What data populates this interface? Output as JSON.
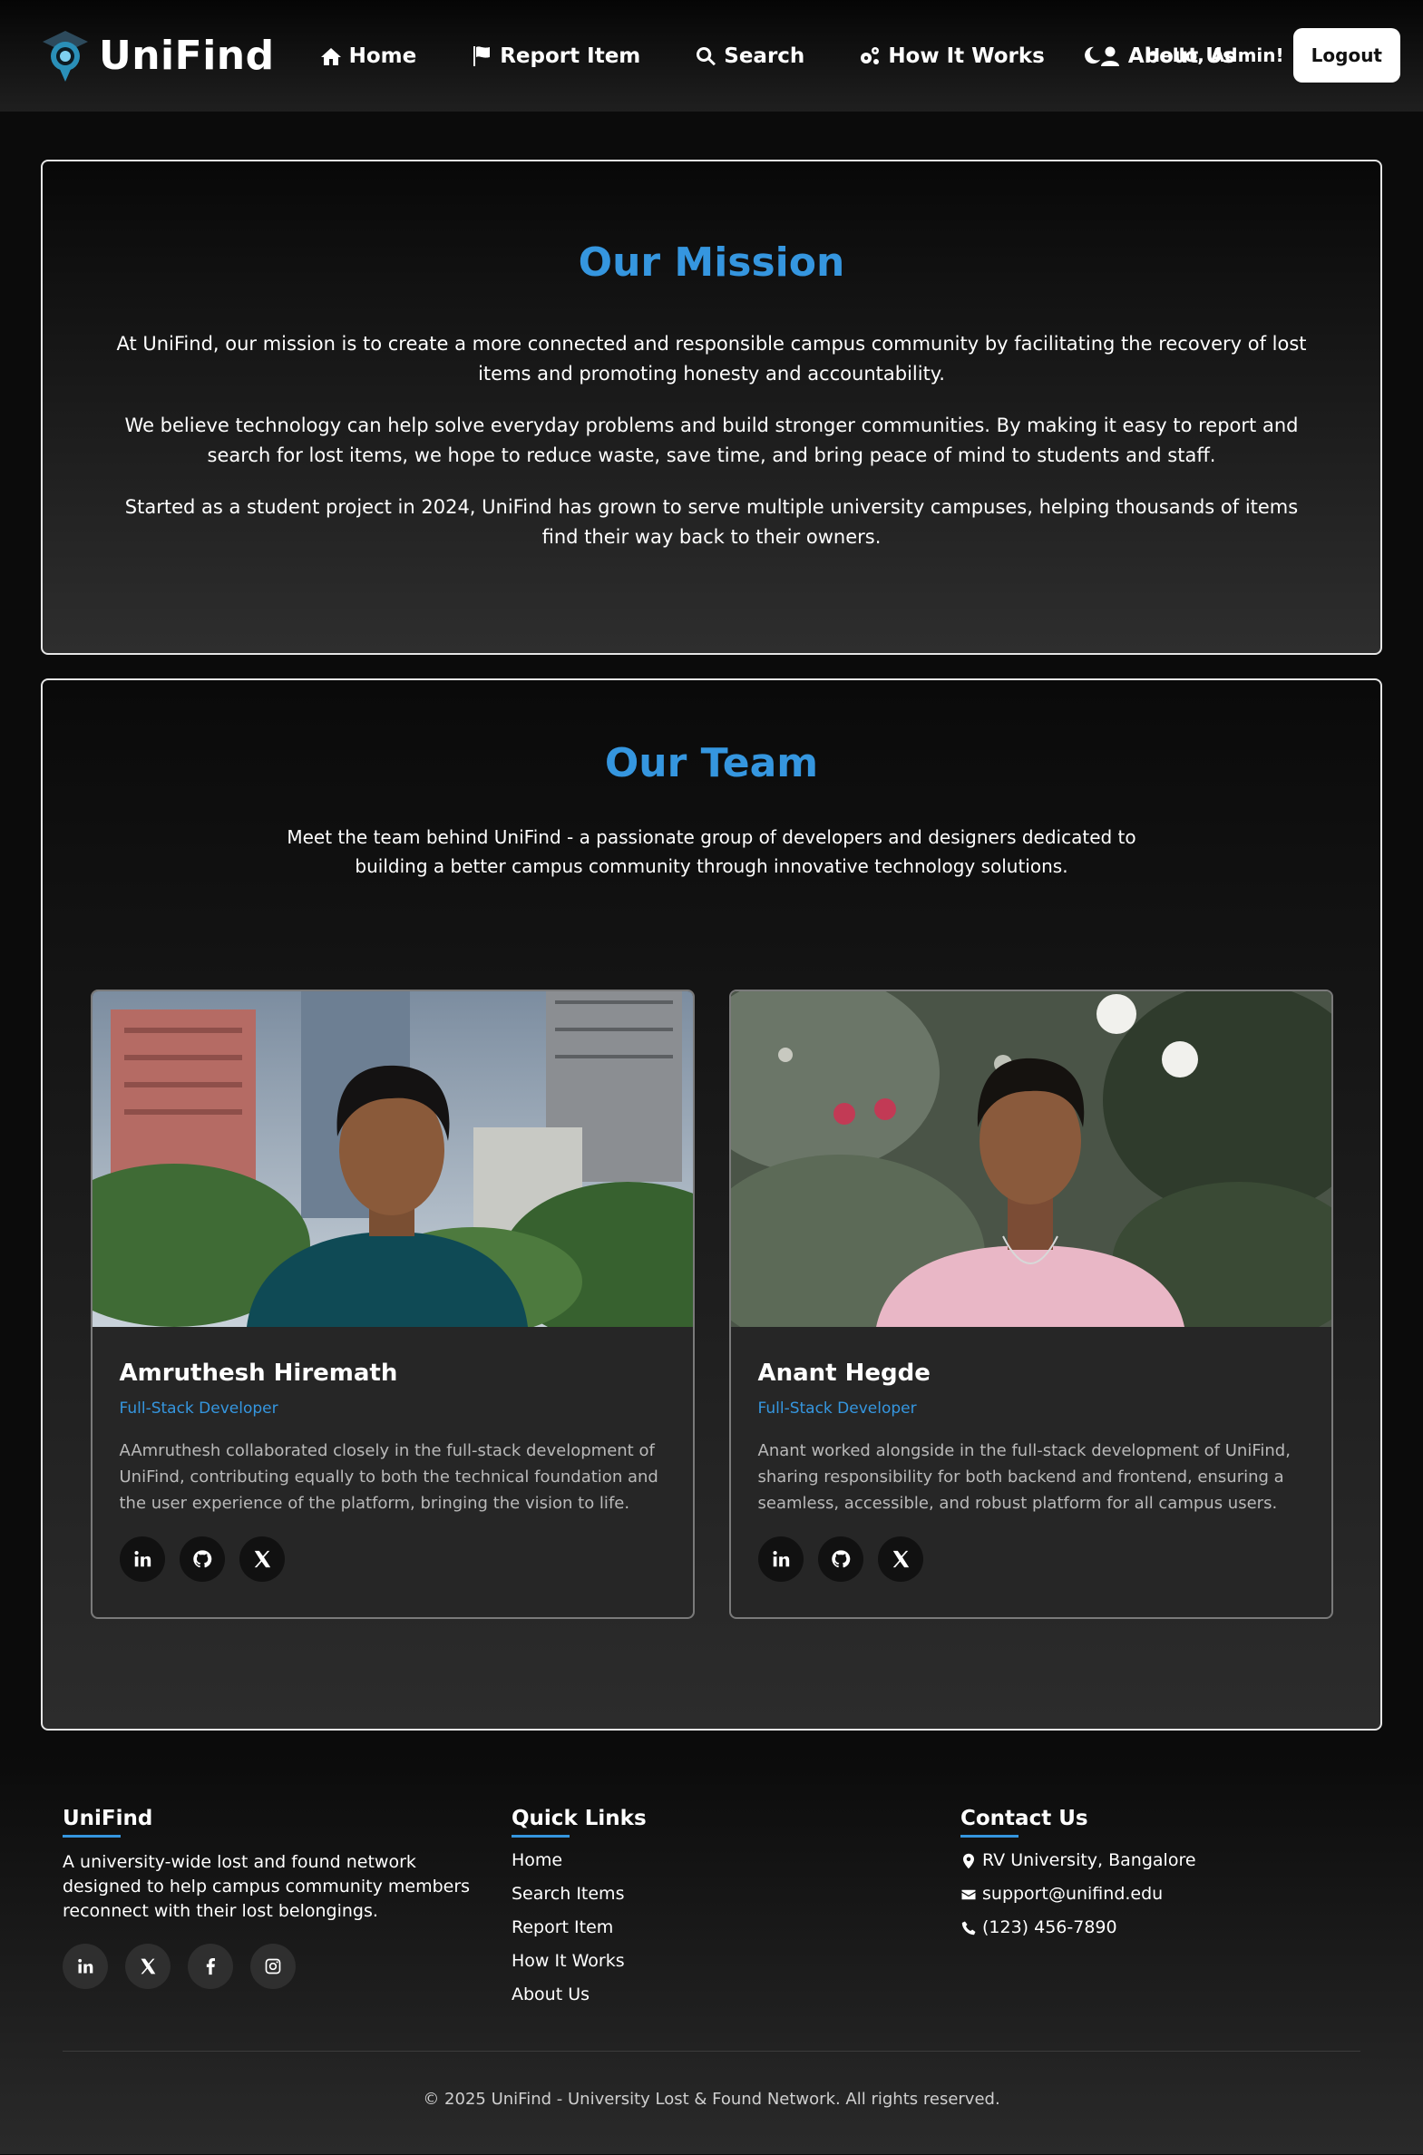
{
  "nav": {
    "brand": "UniFind",
    "links": [
      {
        "label": "Home",
        "icon": "home-icon"
      },
      {
        "label": "Report Item",
        "icon": "flag-icon"
      },
      {
        "label": "Search",
        "icon": "search-icon"
      },
      {
        "label": "How It Works",
        "icon": "gears-icon"
      },
      {
        "label": "About Us",
        "icon": "user-icon"
      }
    ],
    "theme_icon": "moon-icon",
    "greeting": "Hello, Admin!",
    "logout": "Logout"
  },
  "mission": {
    "title": "Our Mission",
    "paragraphs": [
      "At UniFind, our mission is to create a more connected and responsible campus community by facilitating the recovery of lost items and promoting honesty and accountability.",
      "We believe technology can help solve everyday problems and build stronger communities. By making it easy to report and search for lost items, we hope to reduce waste, save time, and bring peace of mind to students and staff.",
      "Started as a student project in 2024, UniFind has grown to serve multiple university campuses, helping thousands of items find their way back to their owners."
    ]
  },
  "team": {
    "title": "Our Team",
    "intro": "Meet the team behind UniFind - a passionate group of developers and designers dedicated to building a better campus community through innovative technology solutions.",
    "members": [
      {
        "name": "Amruthesh Hiremath",
        "role": "Full-Stack Developer",
        "bio": "AAmruthesh collaborated closely in the full-stack development of UniFind, contributing equally to both the technical foundation and the user experience of the platform, bringing the vision to life.",
        "socials": [
          "linkedin-icon",
          "github-icon",
          "x-icon"
        ]
      },
      {
        "name": "Anant Hegde",
        "role": "Full-Stack Developer",
        "bio": "Anant worked alongside in the full-stack development of UniFind, sharing responsibility for both backend and frontend, ensuring a seamless, accessible, and robust platform for all campus users.",
        "socials": [
          "linkedin-icon",
          "github-icon",
          "x-icon"
        ]
      }
    ]
  },
  "footer": {
    "about": {
      "title": "UniFind",
      "description": "A university-wide lost and found network designed to help campus community members reconnect with their lost belongings.",
      "socials": [
        "linkedin-icon",
        "x-icon",
        "facebook-icon",
        "instagram-icon"
      ]
    },
    "quick_links": {
      "title": "Quick Links",
      "items": [
        "Home",
        "Search Items",
        "Report Item",
        "How It Works",
        "About Us"
      ]
    },
    "contact": {
      "title": "Contact Us",
      "items": [
        {
          "icon": "map-pin-icon",
          "text": "RV University, Bangalore"
        },
        {
          "icon": "envelope-icon",
          "text": "support@unifind.edu"
        },
        {
          "icon": "phone-icon",
          "text": "(123) 456-7890"
        }
      ]
    },
    "copyright": "© 2025 UniFind - University Lost & Found Network. All rights reserved."
  },
  "colors": {
    "accent": "#3596df",
    "background": "#0b0b0b",
    "card": "#262626"
  }
}
